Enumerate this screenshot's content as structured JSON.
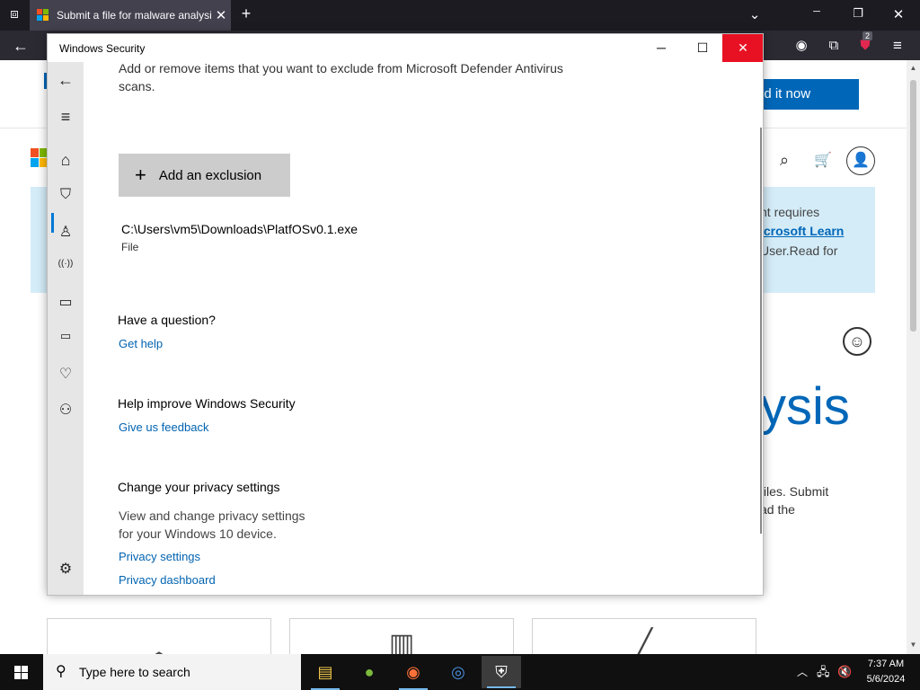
{
  "browser": {
    "tab_title": "Submit a file for malware analysis",
    "tab_close_glyph": "✕",
    "new_tab_glyph": "+",
    "tab_list_glyph": "⌄",
    "win_min": "─",
    "win_restore": "❐",
    "win_close": "✕",
    "back_glyph": "←",
    "account_glyph": "◉",
    "extensions_glyph": "⧉",
    "addon_badge": "2",
    "menu_glyph": "≡"
  },
  "webpage": {
    "cta_label": "dd it now",
    "notice_lines": [
      "nt requires",
      "icrosoft Learn",
      "User.Read for"
    ],
    "hero_text": "ysis",
    "paragraph_lines": [
      "files. Submit",
      "ad the"
    ],
    "smiley_glyph": "☺",
    "search_glyph": "⌕",
    "cart_glyph": "🛒",
    "profile_glyph": "👤"
  },
  "security_window": {
    "title": "Windows Security",
    "min_glyph": "─",
    "max_glyph": "☐",
    "close_glyph": "✕",
    "description": "Add or remove items that you want to exclude from Microsoft Defender Antivirus scans.",
    "add_button_plus": "+",
    "add_button_label": "Add an exclusion",
    "exclusion": {
      "path": "C:\\Users\\vm5\\Downloads\\PlatfOSv0.1.exe",
      "type": "File"
    },
    "question_heading": "Have a question?",
    "get_help_link": "Get help",
    "improve_heading": "Help improve Windows Security",
    "feedback_link": "Give us feedback",
    "privacy_heading": "Change your privacy settings",
    "privacy_text_1": "View and change privacy settings",
    "privacy_text_2": "for your Windows 10 device.",
    "privacy_settings_link": "Privacy settings",
    "privacy_dashboard_link": "Privacy dashboard",
    "sidebar_icons": {
      "back": "←",
      "menu": "≡",
      "home": "⌂",
      "shield": "⛉",
      "account": "♙",
      "firewall": "((·))",
      "app_browser": "▭",
      "device_security": "▭",
      "health": "♡",
      "family": "⚇",
      "settings": "⚙"
    }
  },
  "taskbar": {
    "search_placeholder": "Type here to search",
    "search_glyph": "⚲",
    "tray_chevron": "︿",
    "tray_network": "🖧",
    "tray_volume": "🔇",
    "time": "7:37 AM",
    "date": "5/6/2024"
  },
  "colors": {
    "accent": "#0067b8",
    "close_red": "#e81123",
    "sidebar_bg": "#e6e6e6",
    "notice_bg": "#d4ecf8"
  }
}
